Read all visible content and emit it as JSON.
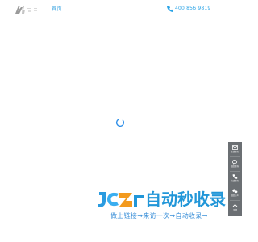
{
  "header": {
    "nav_home": "首页",
    "phone_number": "400 856 9819",
    "logo_icon": "brand-logo-icon"
  },
  "loading": {
    "icon": "loading-spinner-icon",
    "color": "#2f8fe8"
  },
  "side_toolbar": {
    "items": [
      {
        "label": "在线咨询",
        "icon": "mail-icon"
      },
      {
        "label": "微信咨询",
        "icon": "chat-icon"
      },
      {
        "label": "电话咨询",
        "icon": "phone-icon"
      },
      {
        "label": "微信公众",
        "icon": "wechat-icon"
      },
      {
        "label": "顶部",
        "icon": "arrow-up-icon"
      }
    ],
    "background": "#6b6f73"
  },
  "brand": {
    "title": "自动秒收录",
    "slogan": "做上链接→来访一次→自动收录→",
    "color": "#2196d8"
  }
}
